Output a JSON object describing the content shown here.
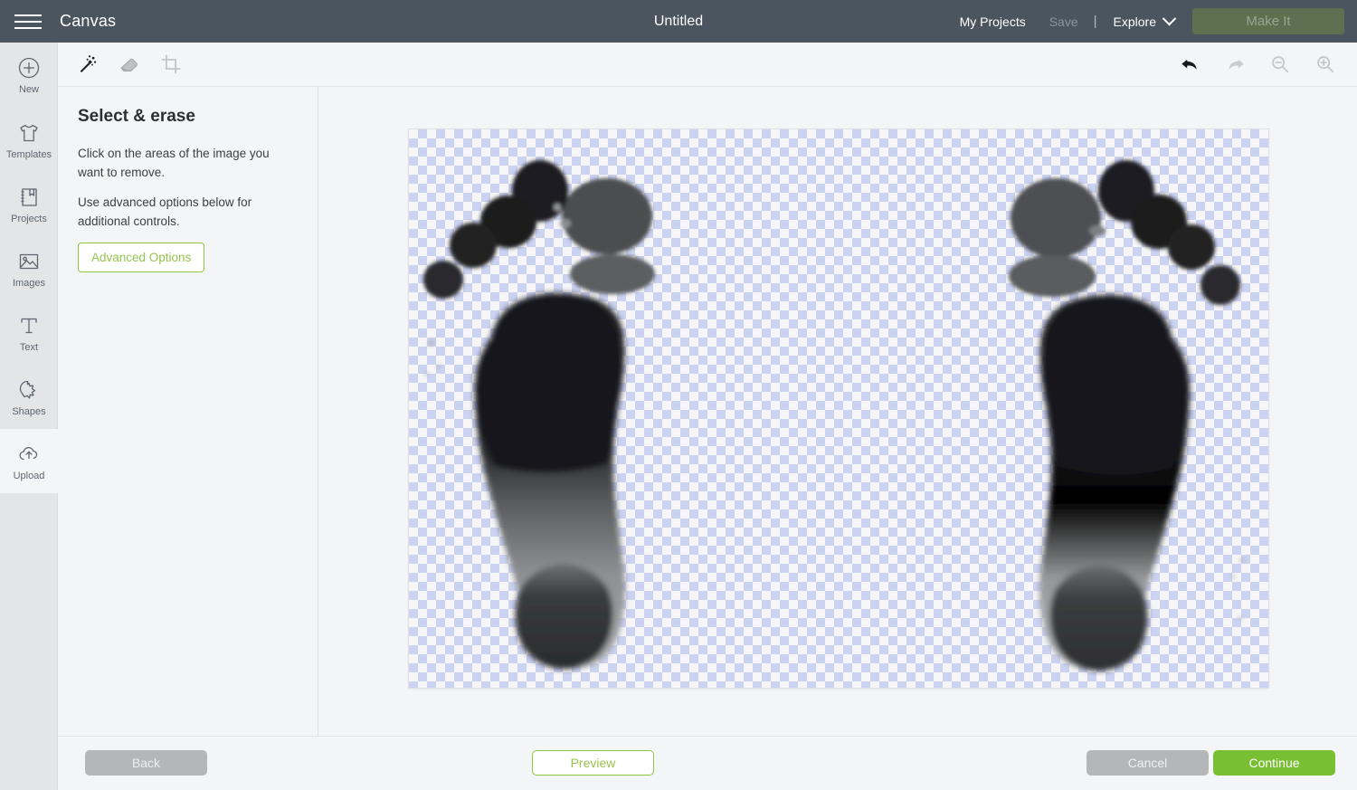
{
  "header": {
    "menu_icon": "hamburger-icon",
    "app_title": "Canvas",
    "document_title": "Untitled",
    "my_projects_label": "My Projects",
    "save_label": "Save",
    "separator": "|",
    "explore_label": "Explore",
    "explore_chevron_icon": "chevron-down-icon",
    "make_it_label": "Make It",
    "colors": {
      "header_bg": "#4b5560",
      "make_it_bg": "#5e7050",
      "make_it_text": "#9aa492",
      "save_text": "#8c949c"
    }
  },
  "sidebar": {
    "items": [
      {
        "label": "New",
        "icon": "plus-circle-icon",
        "active": false
      },
      {
        "label": "Templates",
        "icon": "tshirt-icon",
        "active": false
      },
      {
        "label": "Projects",
        "icon": "notebook-icon",
        "active": false
      },
      {
        "label": "Images",
        "icon": "image-icon",
        "active": false
      },
      {
        "label": "Text",
        "icon": "text-t-icon",
        "active": false
      },
      {
        "label": "Shapes",
        "icon": "star-shapes-icon",
        "active": false
      },
      {
        "label": "Upload",
        "icon": "cloud-upload-icon",
        "active": true
      }
    ]
  },
  "toolbar": {
    "tools": [
      {
        "name": "magic-wand-icon",
        "label": "Magic Wand",
        "active": true
      },
      {
        "name": "eraser-icon",
        "label": "Eraser",
        "active": false
      },
      {
        "name": "crop-icon",
        "label": "Crop",
        "active": false
      }
    ],
    "actions": [
      {
        "name": "undo-icon",
        "label": "Undo",
        "enabled": true
      },
      {
        "name": "redo-icon",
        "label": "Redo",
        "enabled": false
      },
      {
        "name": "zoom-out-icon",
        "label": "Zoom Out",
        "enabled": false
      },
      {
        "name": "zoom-in-icon",
        "label": "Zoom In",
        "enabled": false
      }
    ]
  },
  "panel": {
    "title": "Select & erase",
    "paragraph_1": "Click on the areas of the image you want to remove.",
    "paragraph_2": "Use advanced options below for additional controls.",
    "advanced_options_label": "Advanced Options",
    "accent_color": "#8dc63f"
  },
  "canvas": {
    "transparency_checker_color_a": "#ccd3f2",
    "transparency_checker_color_b": "#f6f6f8",
    "checker_size_px": 10,
    "content_description": "Two black ink footprints on a transparent background",
    "images": [
      {
        "name": "left-footprint",
        "side": "left"
      },
      {
        "name": "right-footprint",
        "side": "right"
      }
    ]
  },
  "footer": {
    "back_label": "Back",
    "preview_label": "Preview",
    "cancel_label": "Cancel",
    "continue_label": "Continue",
    "continue_color": "#79bf34",
    "disabled_color": "#b5b6b8"
  }
}
